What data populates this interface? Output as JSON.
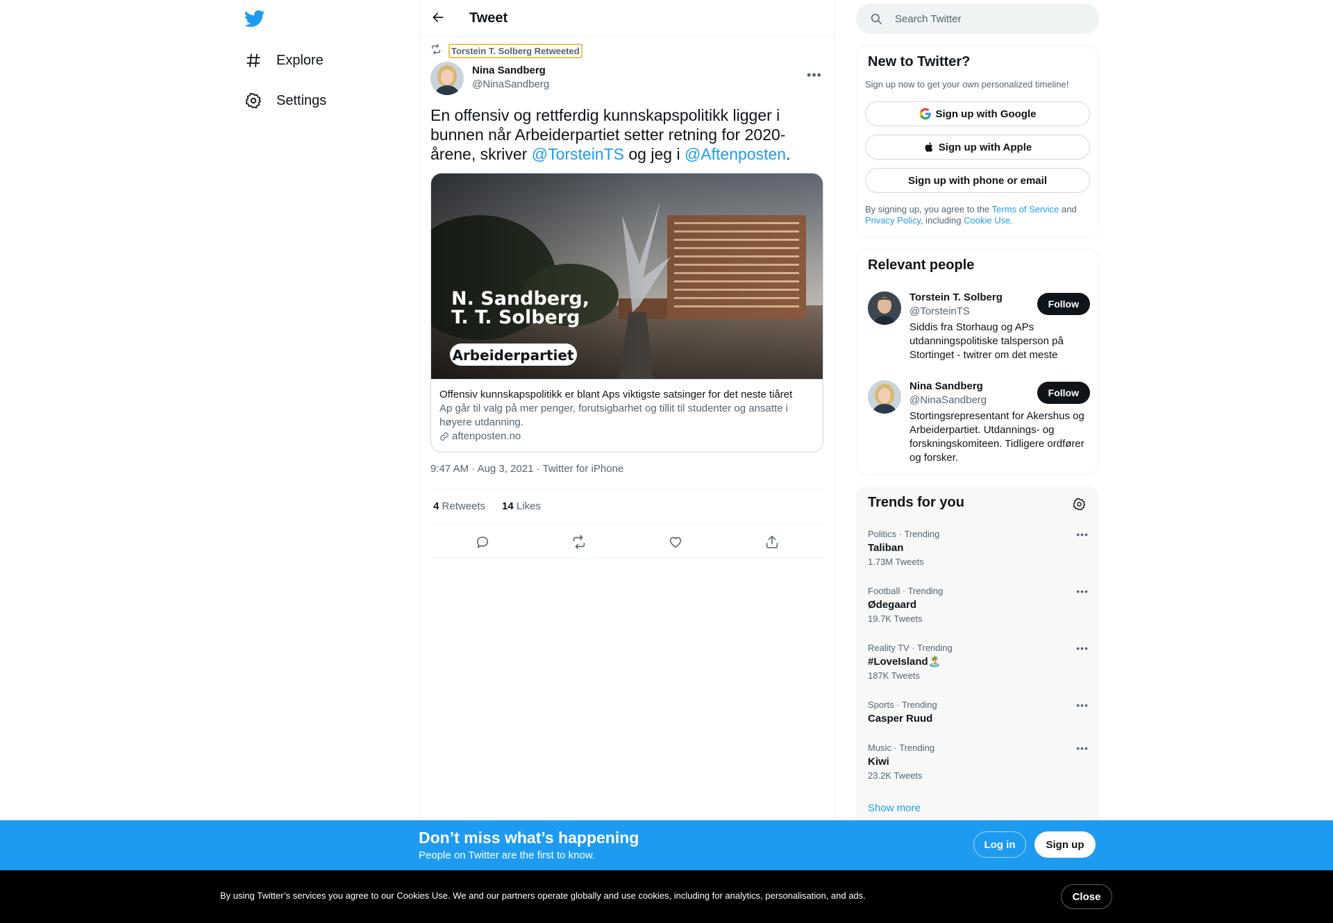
{
  "nav": {
    "logo_icon": "twitter-bird-icon",
    "items": [
      {
        "label": "Explore",
        "icon": "hashtag-icon"
      },
      {
        "label": "Settings",
        "icon": "gear-icon"
      }
    ]
  },
  "header": {
    "title": "Tweet",
    "back_icon": "arrow-left-icon"
  },
  "tweet": {
    "retweeted_by": "Torstein T. Solberg Retweeted",
    "author_name": "Nina Sandberg",
    "author_handle": "@NinaSandberg",
    "text_before": "En offensiv og rettferdig kunnskapspolitikk ligger i bunnen når Arbeiderpartiet setter retning for 2020-årene, skriver ",
    "mention1": "@TorsteinTS",
    "text_middle": " og jeg i ",
    "mention2": "@Aftenposten",
    "text_after": ".",
    "card": {
      "image_line1": "N. Sandberg,",
      "image_line2": "T. T. Solberg",
      "image_badge": "Arbeiderpartiet",
      "title": "Offensiv kunnskapspolitikk er blant Aps viktigste satsinger for det neste tiåret",
      "description": "Ap går til valg på mer penger, forutsigbarhet og tillit til studenter og ansatte i høyere utdanning.",
      "domain": "aftenposten.no"
    },
    "meta": "9:47 AM · Aug 3, 2021 · Twitter for iPhone",
    "retweets_count": "4",
    "retweets_label": "Retweets",
    "likes_count": "14",
    "likes_label": "Likes"
  },
  "search": {
    "placeholder": "Search Twitter"
  },
  "new_to_twitter": {
    "title": "New to Twitter?",
    "subtitle": "Sign up now to get your own personalized timeline!",
    "google": "Sign up with Google",
    "apple": "Sign up with Apple",
    "phone": "Sign up with phone or email",
    "legal_1": "By signing up, you agree to the ",
    "terms": "Terms of Service",
    "legal_2": " and ",
    "privacy": "Privacy Policy",
    "legal_3": ", including ",
    "cookie": "Cookie Use."
  },
  "relevant_people": {
    "title": "Relevant people",
    "people": [
      {
        "name": "Torstein T. Solberg",
        "handle": "@TorsteinTS",
        "bio": "Siddis fra Storhaug og APs utdanningspolitiske talsperson på Stortinget - twitrer om det meste",
        "follow": "Follow"
      },
      {
        "name": "Nina Sandberg",
        "handle": "@NinaSandberg",
        "bio": "Stortingsrepresentant for Akershus og Arbeiderpartiet. Utdannings- og forskningskomiteen. Tidligere ordfører og forsker.",
        "follow": "Follow"
      }
    ]
  },
  "trends": {
    "title": "Trends for you",
    "items": [
      {
        "category": "Politics · Trending",
        "name": "Taliban",
        "count": "1.73M Tweets"
      },
      {
        "category": "Football · Trending",
        "name": "Ødegaard",
        "count": "19.7K Tweets"
      },
      {
        "category": "Reality TV · Trending",
        "name": "#LoveIsland🏝️",
        "count": "187K Tweets"
      },
      {
        "category": "Sports · Trending",
        "name": "Casper Ruud",
        "count": ""
      },
      {
        "category": "Music · Trending",
        "name": "Kiwi",
        "count": "23.2K Tweets"
      }
    ],
    "show_more": "Show more"
  },
  "bottom_bar": {
    "title": "Don’t miss what’s happening",
    "subtitle": "People on Twitter are the first to know.",
    "login": "Log in",
    "signup": "Sign up"
  },
  "cookie_bar": {
    "text": "By using Twitter’s services you agree to our Cookies Use. We and our partners operate globally and use cookies, including for analytics, personalisation, and ads.",
    "close": "Close"
  },
  "colors": {
    "brand": "#1d9bf0",
    "text": "#0f1419",
    "muted": "#536471"
  }
}
